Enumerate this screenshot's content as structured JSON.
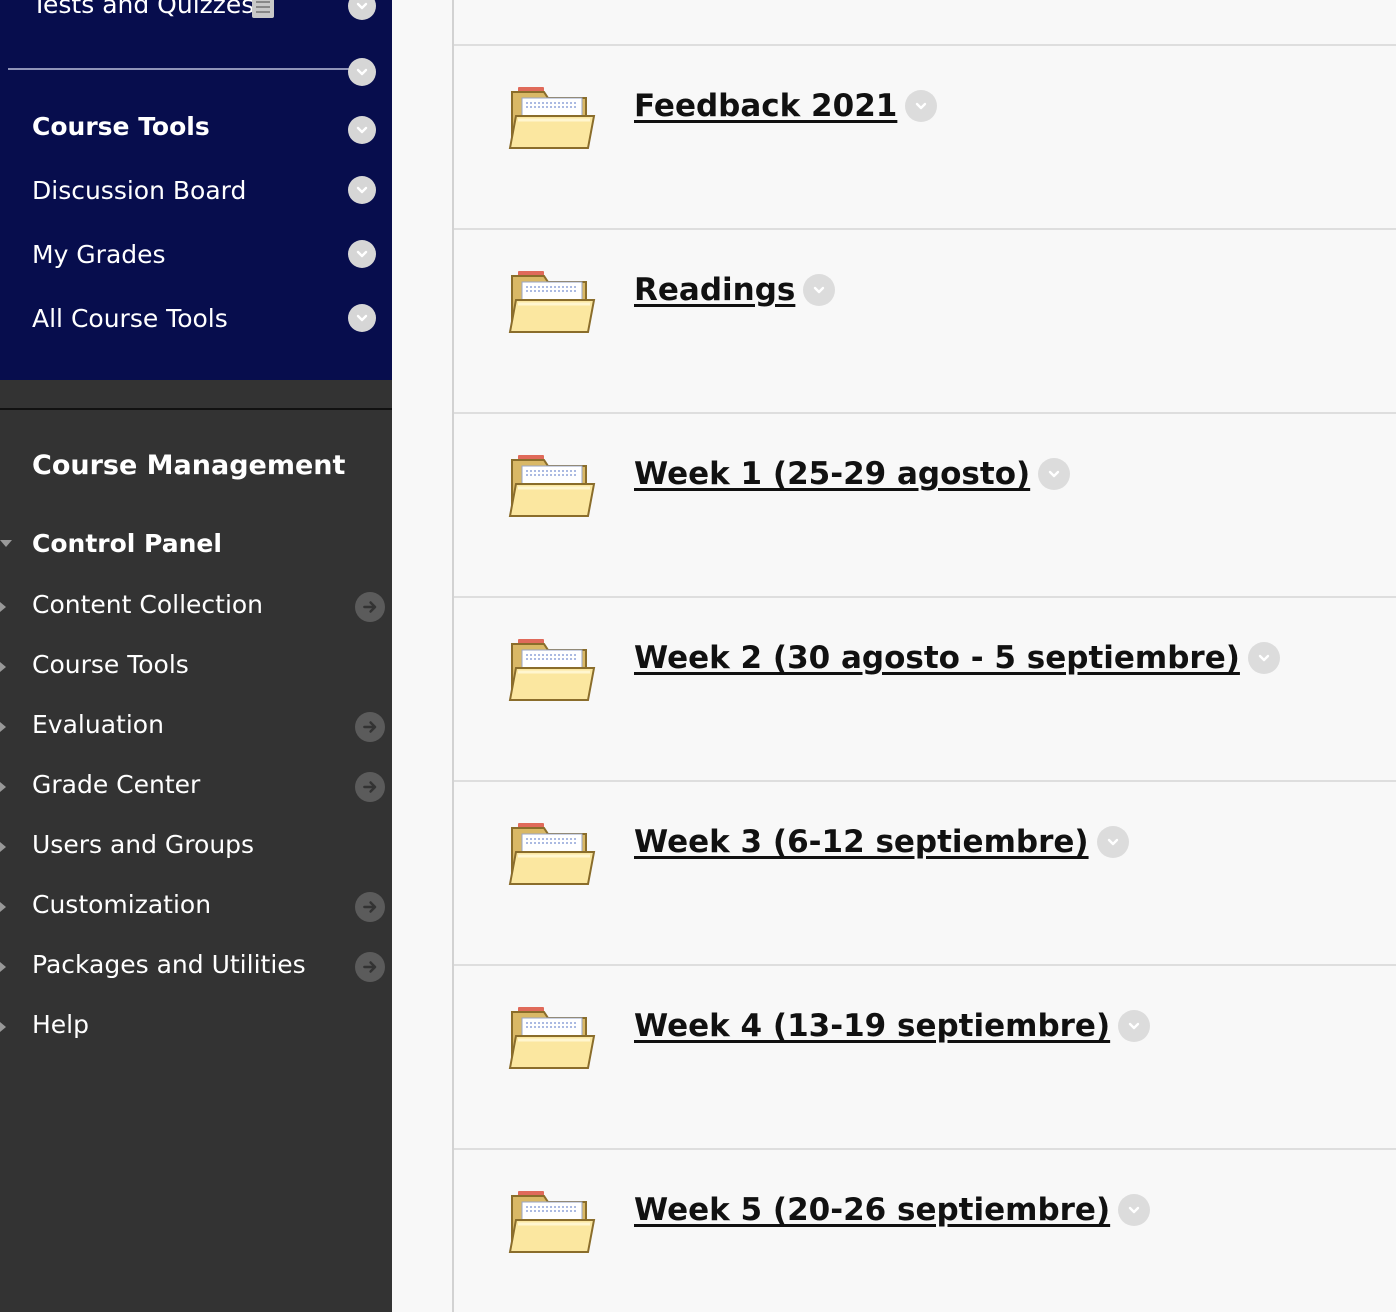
{
  "sidebar": {
    "course_menu": {
      "partial_item": "Tests and Quizzes",
      "items": [
        {
          "label": "Course Tools",
          "bold": true
        },
        {
          "label": "Discussion Board"
        },
        {
          "label": "My Grades"
        },
        {
          "label": "All Course Tools"
        }
      ],
      "bg_color": "#070d4d"
    },
    "management": {
      "title": "Course Management",
      "control_panel": "Control Panel",
      "items": [
        {
          "label": "Content Collection",
          "has_arrow": true
        },
        {
          "label": "Course Tools",
          "has_arrow": false
        },
        {
          "label": "Evaluation",
          "has_arrow": true
        },
        {
          "label": "Grade Center",
          "has_arrow": true
        },
        {
          "label": "Users and Groups",
          "has_arrow": false
        },
        {
          "label": "Customization",
          "has_arrow": true
        },
        {
          "label": "Packages and Utilities",
          "has_arrow": true
        },
        {
          "label": "Help",
          "has_arrow": false
        }
      ],
      "bg_color": "#333333"
    }
  },
  "content": {
    "items": [
      {
        "title": "Feedback 2021",
        "icon": "folder-icon"
      },
      {
        "title": "Readings",
        "icon": "folder-icon"
      },
      {
        "title": "Week 1 (25-29 agosto)",
        "icon": "folder-icon"
      },
      {
        "title": "Week 2 (30 agosto - 5 septiembre)",
        "icon": "folder-icon"
      },
      {
        "title": "Week 3 (6-12 septiembre)",
        "icon": "folder-icon"
      },
      {
        "title": "Week 4 (13-19 septiembre)",
        "icon": "folder-icon"
      },
      {
        "title": "Week 5 (20-26 septiembre)",
        "icon": "folder-icon"
      }
    ]
  }
}
